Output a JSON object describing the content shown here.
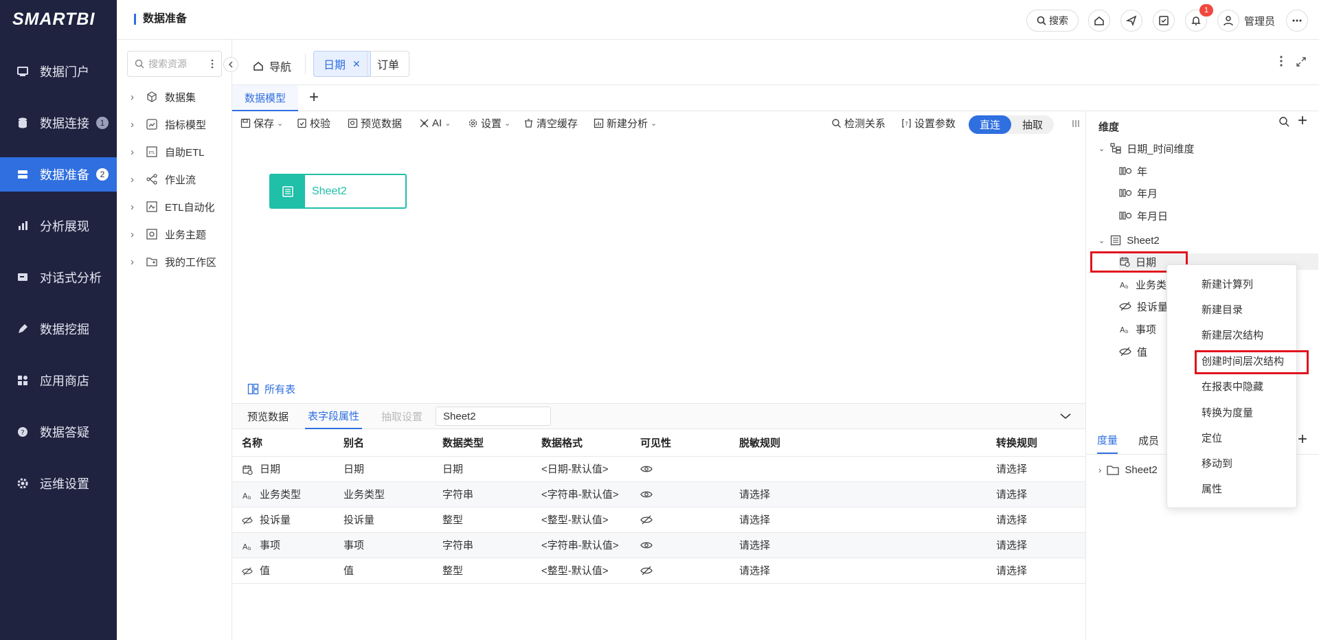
{
  "brand": "SMARTBI",
  "nav": {
    "items": [
      {
        "label": "数据门户",
        "badge": ""
      },
      {
        "label": "数据连接",
        "badge": "1"
      },
      {
        "label": "数据准备",
        "badge": "2"
      },
      {
        "label": "分析展现",
        "badge": ""
      },
      {
        "label": "对话式分析",
        "badge": ""
      },
      {
        "label": "数据挖掘",
        "badge": ""
      },
      {
        "label": "应用商店",
        "badge": ""
      },
      {
        "label": "数据答疑",
        "badge": ""
      },
      {
        "label": "运维设置",
        "badge": ""
      }
    ]
  },
  "topbar": {
    "title": "数据准备",
    "search_label": "搜索",
    "notif_count": "1",
    "user": "管理员"
  },
  "resources": {
    "search_placeholder": "搜索资源",
    "items": [
      "数据集",
      "指标模型",
      "自助ETL",
      "作业流",
      "ETL自动化",
      "业务主题",
      "我的工作区"
    ]
  },
  "tabs": {
    "nav_label": "导航",
    "tab1": "日期",
    "tab2": "订单"
  },
  "subtab": "数据模型",
  "toolbar": {
    "save": "保存",
    "validate": "校验",
    "preview": "预览数据",
    "ai": "AI",
    "settings": "设置",
    "clear_cache": "清空缓存",
    "new_analysis": "新建分析",
    "detect": "检测关系",
    "params": "设置参数",
    "direct": "直连",
    "extract": "抽取"
  },
  "canvas": {
    "node_label": "Sheet2",
    "all_tables": "所有表"
  },
  "bottom": {
    "tab_preview": "预览数据",
    "tab_fields": "表字段属性",
    "tab_extract": "抽取设置",
    "sheet_value": "Sheet2",
    "columns": [
      "名称",
      "别名",
      "数据类型",
      "数据格式",
      "可见性",
      "脱敏规则",
      "转换规则"
    ],
    "rows": [
      {
        "name": "日期",
        "alias": "日期",
        "type": "日期",
        "format": "<日期-默认值>",
        "mask": "",
        "convert": "请选择",
        "icon": "calendar-icon",
        "visible": "eye-icon"
      },
      {
        "name": "业务类型",
        "alias": "业务类型",
        "type": "字符串",
        "format": "<字符串-默认值>",
        "mask": "请选择",
        "convert": "请选择",
        "icon": "text-icon",
        "visible": "eye-icon"
      },
      {
        "name": "投诉量",
        "alias": "投诉量",
        "type": "整型",
        "format": "<整型-默认值>",
        "mask": "请选择",
        "convert": "请选择",
        "icon": "hidden-icon",
        "visible": "eye-off-icon"
      },
      {
        "name": "事项",
        "alias": "事项",
        "type": "字符串",
        "format": "<字符串-默认值>",
        "mask": "请选择",
        "convert": "请选择",
        "icon": "text-icon",
        "visible": "eye-icon"
      },
      {
        "name": "值",
        "alias": "值",
        "type": "整型",
        "format": "<整型-默认值>",
        "mask": "请选择",
        "convert": "请选择",
        "icon": "hidden-icon",
        "visible": "eye-off-icon"
      }
    ]
  },
  "right": {
    "dim_title": "维度",
    "time_dim": "日期_时间维度",
    "time_items": [
      "年",
      "年月",
      "年月日"
    ],
    "sheet": "Sheet2",
    "fields": [
      "日期",
      "业务类",
      "投诉量",
      "事项",
      "值"
    ],
    "measure_tab": "度量",
    "member_tab": "成员",
    "measure_sheet": "Sheet2"
  },
  "context_menu": [
    "新建计算列",
    "新建目录",
    "新建层次结构",
    "创建时间层次结构",
    "在报表中隐藏",
    "转换为度量",
    "定位",
    "移动到",
    "属性"
  ],
  "colors": {
    "accent": "#2f6fe0",
    "nav_bg": "#1f2340",
    "node": "#1fbfa8",
    "highlight": "#e0141e"
  }
}
